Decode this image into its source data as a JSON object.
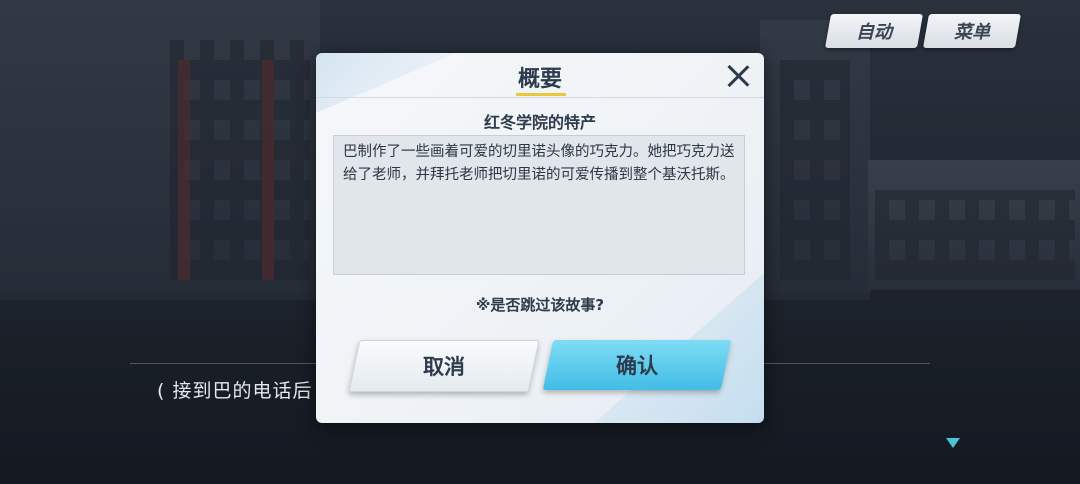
{
  "top_bar": {
    "auto_label": "自动",
    "menu_label": "菜单"
  },
  "story": {
    "line_text": "( 接到巴的电话后"
  },
  "dialog": {
    "title": "概要",
    "subtitle": "红冬学院的特产",
    "summary": "巴制作了一些画着可爱的切里诺头像的巧克力。她把巧克力送给了老师，并拜托老师把切里诺的可爱传播到整个基沃托斯。",
    "question": "※是否跳过该故事?",
    "cancel_label": "取消",
    "confirm_label": "确认"
  },
  "colors": {
    "accent_yellow": "#e8c93a",
    "confirm_blue": "#42bde6",
    "next_arrow": "#4dc3d9"
  },
  "icons": {
    "close": "close-icon",
    "next": "next-arrow-icon"
  }
}
